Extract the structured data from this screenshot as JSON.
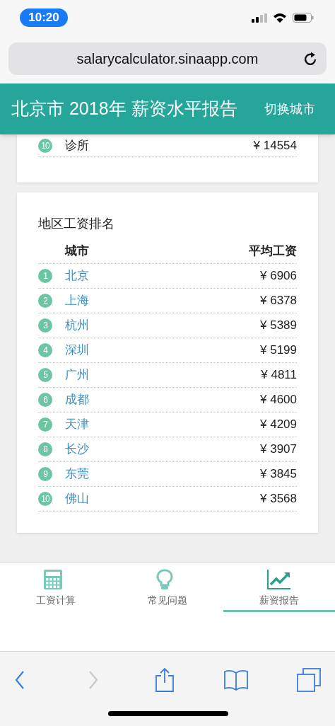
{
  "status_bar": {
    "time": "10:20"
  },
  "browser": {
    "url": "salarycalculator.sinaapp.com"
  },
  "header": {
    "title": "北京市 2018年 薪资水平报告",
    "action": "切换城市"
  },
  "previous_card": {
    "rows": [
      {
        "rank": "10",
        "name": "诊所",
        "salary": "¥ 14554"
      }
    ]
  },
  "ranking_card": {
    "title": "地区工资排名",
    "columns": [
      "城市",
      "平均工资"
    ],
    "rows": [
      {
        "rank": "1",
        "city": "北京",
        "salary": "¥ 6906"
      },
      {
        "rank": "2",
        "city": "上海",
        "salary": "¥ 6378"
      },
      {
        "rank": "3",
        "city": "杭州",
        "salary": "¥ 5389"
      },
      {
        "rank": "4",
        "city": "深圳",
        "salary": "¥ 5199"
      },
      {
        "rank": "5",
        "city": "广州",
        "salary": "¥ 4811"
      },
      {
        "rank": "6",
        "city": "成都",
        "salary": "¥ 4600"
      },
      {
        "rank": "7",
        "city": "天津",
        "salary": "¥ 4209"
      },
      {
        "rank": "8",
        "city": "长沙",
        "salary": "¥ 3907"
      },
      {
        "rank": "9",
        "city": "东莞",
        "salary": "¥ 3845"
      },
      {
        "rank": "10",
        "city": "佛山",
        "salary": "¥ 3568"
      }
    ]
  },
  "tabs": [
    {
      "label": "工资计算",
      "kind": "calculator",
      "selected": false
    },
    {
      "label": "常见问题",
      "kind": "bulb",
      "selected": false
    },
    {
      "label": "薪资报告",
      "kind": "chart",
      "selected": true
    }
  ],
  "browser_toolbar": {
    "back": {
      "disabled": false
    },
    "forward": {
      "disabled": true
    }
  }
}
